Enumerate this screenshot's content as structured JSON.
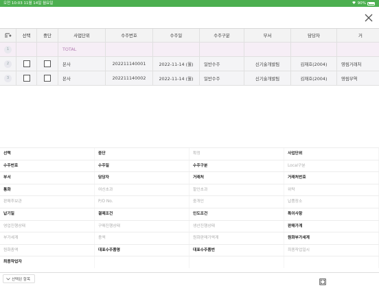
{
  "status_bar": {
    "time_date": "오전 10:03   11월 14일 월요일",
    "battery": "90%"
  },
  "grid": {
    "headers": [
      "선택",
      "중단",
      "사업단위",
      "수주번호",
      "수주일",
      "수주구분",
      "부서",
      "담당자",
      "거"
    ],
    "total_row": {
      "num": "1",
      "label": "TOTAL"
    },
    "rows": [
      {
        "num": "2",
        "business_unit": "본사",
        "order_no": "202211140001",
        "order_date": "2022-11-14 (월)",
        "order_type": "일반수주",
        "department": "신기술개발팀",
        "manager": "김재호(2004)",
        "client": "영림거래처"
      },
      {
        "num": "3",
        "business_unit": "본사",
        "order_no": "202211140002",
        "order_date": "2022-11-14 (월)",
        "order_type": "일반수주",
        "department": "신기술개발팀",
        "manager": "김재호(2004)",
        "client": "영림무역"
      }
    ]
  },
  "form_fields": [
    [
      "선택",
      "중단",
      "확정",
      "사업단위"
    ],
    [
      "수주번호",
      "수주일",
      "수주구분",
      "Local구분"
    ],
    [
      "부서",
      "담당자",
      "거래처",
      "거래처번호"
    ],
    [
      "통화",
      "여신초과",
      "할인초과",
      "위탁"
    ],
    [
      "판매후보관",
      "P/O No.",
      "중개인",
      "납품장소"
    ],
    [
      "납기일",
      "결제조건",
      "인도조건",
      "특이사항"
    ],
    [
      "영업진행상태",
      "구매진행상태",
      "생산진행상태",
      "판매가계"
    ],
    [
      "부가세계",
      "총액",
      "원화판매가액계",
      "원화부가세계"
    ],
    [
      "원화총액",
      "대표수주품명",
      "대표수주품번",
      "최종작업일시"
    ],
    [
      "최종작업자",
      "",
      "",
      ""
    ]
  ],
  "form_bold": [
    [
      true,
      true,
      false,
      true
    ],
    [
      true,
      true,
      true,
      false
    ],
    [
      true,
      true,
      true,
      true
    ],
    [
      true,
      false,
      false,
      false
    ],
    [
      false,
      false,
      false,
      false
    ],
    [
      true,
      true,
      true,
      true
    ],
    [
      false,
      false,
      false,
      true
    ],
    [
      false,
      false,
      false,
      true
    ],
    [
      false,
      true,
      true,
      false
    ],
    [
      true,
      false,
      false,
      false
    ]
  ],
  "footer": {
    "selected_items_label": "선택된 항목"
  }
}
